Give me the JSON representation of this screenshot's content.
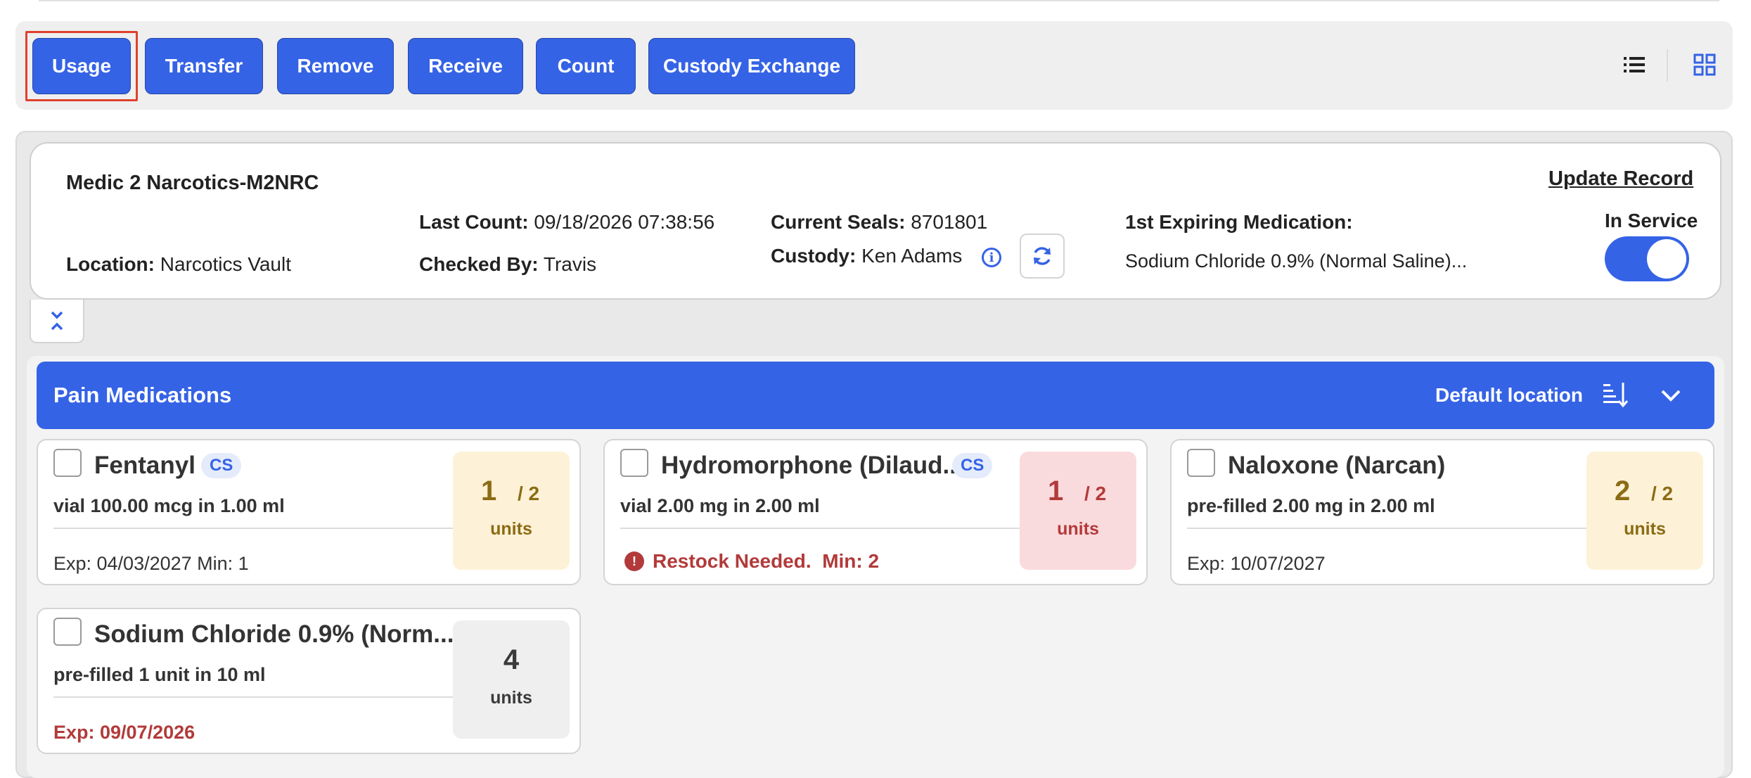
{
  "toolbar": {
    "buttons": {
      "usage": "Usage",
      "transfer": "Transfer",
      "remove": "Remove",
      "receive": "Receive",
      "count": "Count",
      "custody_exchange": "Custody Exchange"
    },
    "view_icons": [
      "list-view-icon",
      "grid-view-icon"
    ]
  },
  "unit": {
    "name": "Medic 2 Narcotics-M2NRC",
    "location_label": "Location:",
    "location": "Narcotics Vault",
    "last_count_label": "Last Count:",
    "last_count": "09/18/2026 07:38:56",
    "checked_by_label": "Checked By:",
    "checked_by": "Travis",
    "current_seals_label": "Current Seals:",
    "current_seals": "8701801",
    "custody_label": "Custody:",
    "custody": "Ken Adams",
    "first_expiring_label": "1st Expiring Medication:",
    "first_expiring": "Sodium Chloride 0.9% (Normal Saline)...",
    "update_record": "Update Record",
    "in_service_label": "In Service",
    "in_service": true
  },
  "group": {
    "title": "Pain Medications",
    "default_location": "Default location"
  },
  "medications": [
    {
      "name": "Fentanyl",
      "cs": "CS",
      "description": "vial 100.00 mcg in 1.00 ml",
      "footer": "Exp: 04/03/2027 Min: 1",
      "qty": "1",
      "par": "/ 2",
      "unit": "units",
      "status_color": "#fdf2d7"
    },
    {
      "name": "Hydromorphone (Dilaud...",
      "cs": "CS",
      "description": "vial 2.00 mg in 2.00 ml",
      "alert": "Restock Needed.  Min: 2",
      "qty": "1",
      "par": "/ 2",
      "unit": "units",
      "status_color": "#fadbdd"
    },
    {
      "name": "Naloxone (Narcan)",
      "description": "pre-filled 2.00 mg in 2.00 ml",
      "footer": "Exp: 10/07/2027",
      "qty": "2",
      "par": "/ 2",
      "unit": "units",
      "status_color": "#fdf2d7"
    },
    {
      "name": "Sodium Chloride 0.9% (Norm...",
      "description": "pre-filled 1 unit in 10 ml",
      "footer": "Exp: 09/07/2026",
      "qty": "4",
      "unit": "units",
      "status_color": "#efefef"
    }
  ],
  "colors": {
    "primary": "#3563e6",
    "danger": "#b23a3a",
    "warning_bg": "#fdf2d7",
    "danger_bg": "#fadbdd"
  }
}
